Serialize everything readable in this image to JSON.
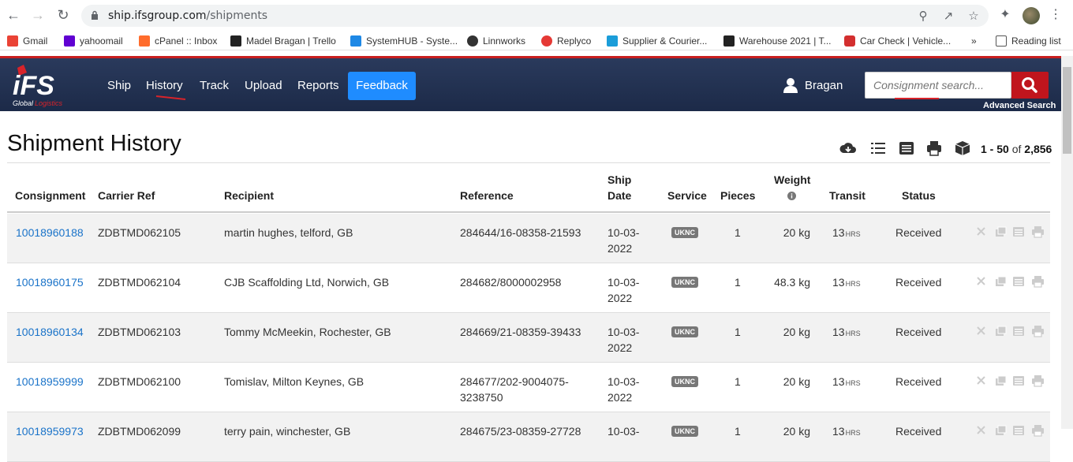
{
  "browser": {
    "url_host": "ship.ifsgroup.com",
    "url_path": "/shipments",
    "bookmarks": [
      {
        "label": "Gmail",
        "color": "#ea4335"
      },
      {
        "label": "yahoomail",
        "color": "#6001d2"
      },
      {
        "label": "cPanel :: Inbox",
        "color": "#ff6c2c"
      },
      {
        "label": "Madel Bragan | Trello",
        "color": "#222222"
      },
      {
        "label": "SystemHUB - Syste...",
        "color": "#1e88e5"
      },
      {
        "label": "Linnworks",
        "color": "#333333"
      },
      {
        "label": "Replyco",
        "color": "#e53935"
      },
      {
        "label": "Supplier & Courier...",
        "color": "#1b9dd9"
      },
      {
        "label": "Warehouse 2021 | T...",
        "color": "#222222"
      },
      {
        "label": "Car Check | Vehicle...",
        "color": "#d32f2f"
      }
    ],
    "more_bookmarks": "»",
    "reading_list": "Reading list"
  },
  "header": {
    "nav": [
      "Ship",
      "History",
      "Track",
      "Upload",
      "Reports"
    ],
    "feedback_label": "Feedback",
    "user_name": "Bragan",
    "search_placeholder": "Consignment search...",
    "advanced_search": "Advanced Search",
    "accent_red": "#c0151d",
    "feedback_blue": "#1f8cff"
  },
  "page": {
    "title": "Shipment History",
    "paging_range": "1 - 50",
    "paging_of": "of",
    "paging_total": "2,856"
  },
  "table": {
    "columns": {
      "consignment": "Consignment",
      "carrier_ref": "Carrier Ref",
      "recipient": "Recipient",
      "reference": "Reference",
      "ship_date_1": "Ship",
      "ship_date_2": "Date",
      "service": "Service",
      "pieces": "Pieces",
      "weight": "Weight",
      "transit": "Transit",
      "status": "Status"
    },
    "rows": [
      {
        "consignment": "10018960188",
        "carrier_ref": "ZDBTMD062105",
        "recipient": "martin hughes, telford, GB",
        "reference_1": "284644/16-08358-21593",
        "reference_2": "",
        "date_1": "10-03-",
        "date_2": "2022",
        "service": "UKNC",
        "pieces": "1",
        "weight": "20 kg",
        "transit": "13",
        "transit_unit": "HRS",
        "status": "Received"
      },
      {
        "consignment": "10018960175",
        "carrier_ref": "ZDBTMD062104",
        "recipient": "CJB Scaffolding Ltd, Norwich, GB",
        "reference_1": "284682/8000002958",
        "reference_2": "",
        "date_1": "10-03-",
        "date_2": "2022",
        "service": "UKNC",
        "pieces": "1",
        "weight": "48.3 kg",
        "transit": "13",
        "transit_unit": "HRS",
        "status": "Received"
      },
      {
        "consignment": "10018960134",
        "carrier_ref": "ZDBTMD062103",
        "recipient": "Tommy McMeekin, Rochester, GB",
        "reference_1": "284669/21-08359-39433",
        "reference_2": "",
        "date_1": "10-03-",
        "date_2": "2022",
        "service": "UKNC",
        "pieces": "1",
        "weight": "20 kg",
        "transit": "13",
        "transit_unit": "HRS",
        "status": "Received"
      },
      {
        "consignment": "10018959999",
        "carrier_ref": "ZDBTMD062100",
        "recipient": "Tomislav, Milton Keynes, GB",
        "reference_1": "284677/202-9004075-",
        "reference_2": "3238750",
        "date_1": "10-03-",
        "date_2": "2022",
        "service": "UKNC",
        "pieces": "1",
        "weight": "20 kg",
        "transit": "13",
        "transit_unit": "HRS",
        "status": "Received"
      },
      {
        "consignment": "10018959973",
        "carrier_ref": "ZDBTMD062099",
        "recipient": "terry pain, winchester, GB",
        "reference_1": "284675/23-08359-27728",
        "reference_2": "",
        "date_1": "10-03-",
        "date_2": "",
        "service": "UKNC",
        "pieces": "1",
        "weight": "20 kg",
        "transit": "13",
        "transit_unit": "HRS",
        "status": "Received"
      }
    ]
  }
}
